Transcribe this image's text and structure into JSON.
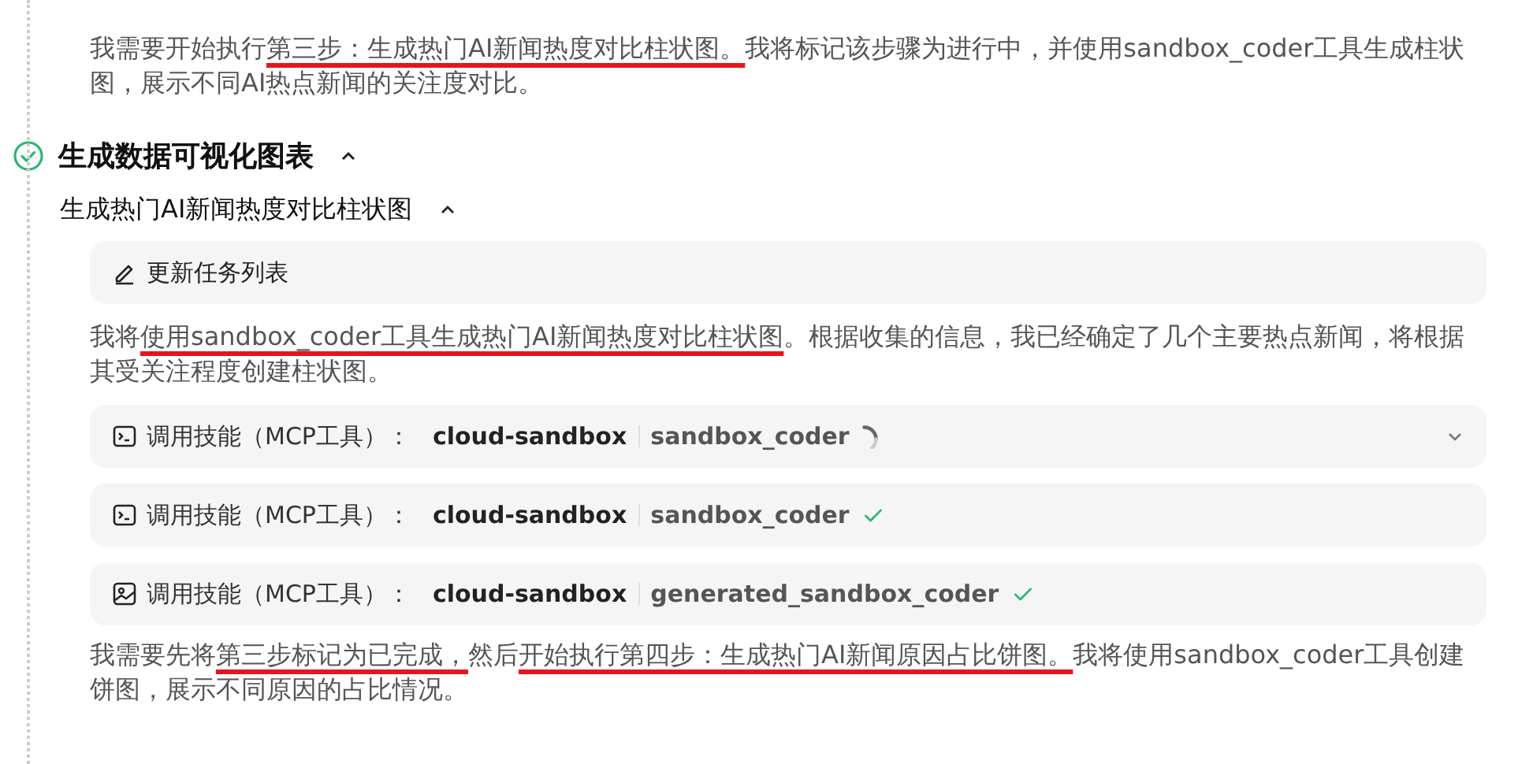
{
  "intro": [
    {
      "text": "我需要开始执行",
      "underlined": false
    },
    {
      "text": "第三步：生成热门AI新闻热度对比柱状图。",
      "underlined": true
    },
    {
      "text": "我将标记该步骤为进行中，并使用sandbox_coder工具生成柱状图，展示不同AI热点新闻的关注度对比。",
      "underlined": false
    }
  ],
  "section": {
    "title": "生成数据可视化图表",
    "done": true,
    "expanded": true
  },
  "subsection": {
    "title": "生成热门AI新闻热度对比柱状图",
    "expanded": true
  },
  "task_card": {
    "label": "更新任务列表"
  },
  "message": [
    {
      "text": "我将",
      "underlined": false
    },
    {
      "text": "使用sandbox_coder工具生成热门AI新闻热度对比柱状图",
      "underlined": true
    },
    {
      "text": "。根据收集的信息，我已经确定了几个主要热点新闻，将根据其受关注程度创建柱状图。",
      "underlined": false
    }
  ],
  "tool_calls": [
    {
      "kind": "terminal",
      "label": "调用技能（MCP工具）：",
      "server": "cloud-sandbox",
      "tool": "sandbox_coder",
      "done": false,
      "collapsed": true
    },
    {
      "kind": "terminal",
      "label": "调用技能（MCP工具）：",
      "server": "cloud-sandbox",
      "tool": "sandbox_coder",
      "done": true,
      "collapsed": false
    },
    {
      "kind": "image",
      "label": "调用技能（MCP工具）：",
      "server": "cloud-sandbox",
      "tool": "generated_sandbox_coder",
      "done": true,
      "collapsed": false
    }
  ],
  "outro": [
    {
      "text": "我需要先将",
      "underlined": false
    },
    {
      "text": "第三步标记为已完成，",
      "underlined": true
    },
    {
      "text": "然后",
      "underlined": false
    },
    {
      "text": "开始执行第四步：生成热门AI新闻原因占比饼图。",
      "underlined": true
    },
    {
      "text": "我将使用sandbox_coder工具创建饼图，展示不同原因的占比情况。",
      "underlined": false
    }
  ]
}
